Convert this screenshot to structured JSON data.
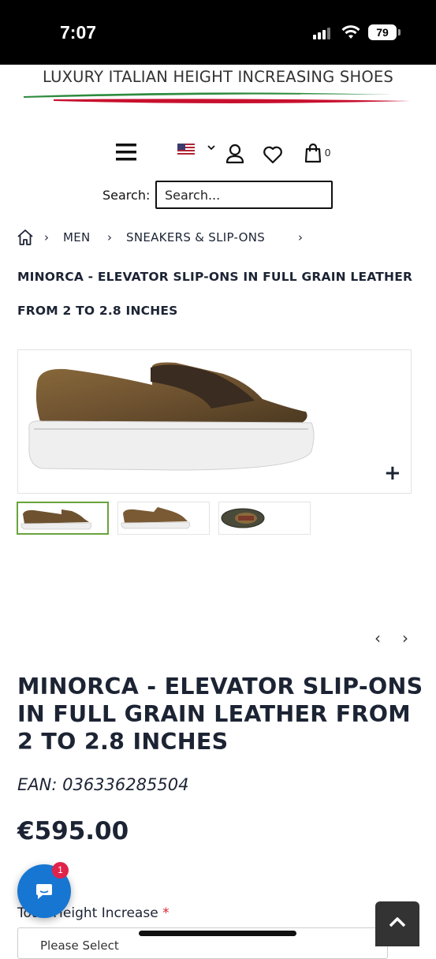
{
  "status_bar": {
    "time": "7:07",
    "battery": "79"
  },
  "logo": {
    "text": "LUXURY ITALIAN HEIGHT INCREASING SHOES"
  },
  "header": {
    "cart_count": "0"
  },
  "search": {
    "label": "Search:",
    "placeholder": "Search..."
  },
  "breadcrumb": {
    "items": [
      {
        "label": "MEN"
      },
      {
        "label": "SNEAKERS & SLIP-ONS"
      }
    ],
    "current": "MINORCA - ELEVATOR SLIP-ONS IN FULL GRAIN LEATHER FROM 2 TO 2.8 INCHES"
  },
  "gallery": {
    "zoom_symbol": "+",
    "prev": "‹",
    "next": "›"
  },
  "product": {
    "title": "MINORCA - ELEVATOR SLIP-ONS IN FULL GRAIN LEATHER FROM 2 TO 2.8 INCHES",
    "ean": "EAN: 036336285504",
    "price": "€595.00",
    "height_label": "Total Height Increase",
    "height_required_mark": "*",
    "height_select_value": "Please Select"
  },
  "chat": {
    "badge_count": "1"
  },
  "colors": {
    "accent_green": "#6aa33c",
    "chat_blue": "#1776d2",
    "badge_red": "#e0234a",
    "text_dark": "#1c2434"
  }
}
